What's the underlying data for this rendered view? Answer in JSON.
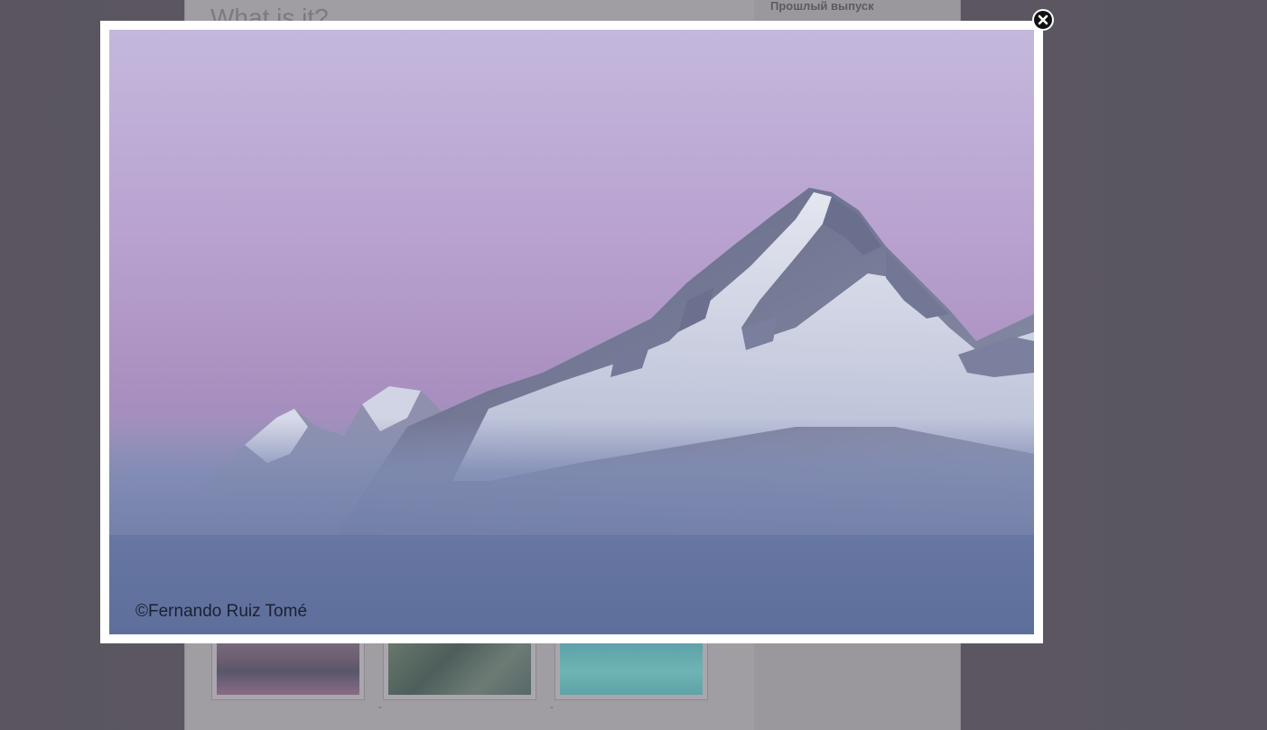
{
  "page": {
    "title": "What is it?",
    "sidebar_heading": "Прошлый выпуск",
    "thumbnail_captions": [
      "-",
      "-"
    ]
  },
  "lightbox": {
    "credit": "©Fernando Ruiz Tomé",
    "close_icon": "close-icon"
  },
  "colors": {
    "overlay": "#5e5963",
    "frame": "#ffffff",
    "sky_top": "#c3b6dc",
    "sky_mid": "#b397c6",
    "fog": "#6f7fa6"
  }
}
